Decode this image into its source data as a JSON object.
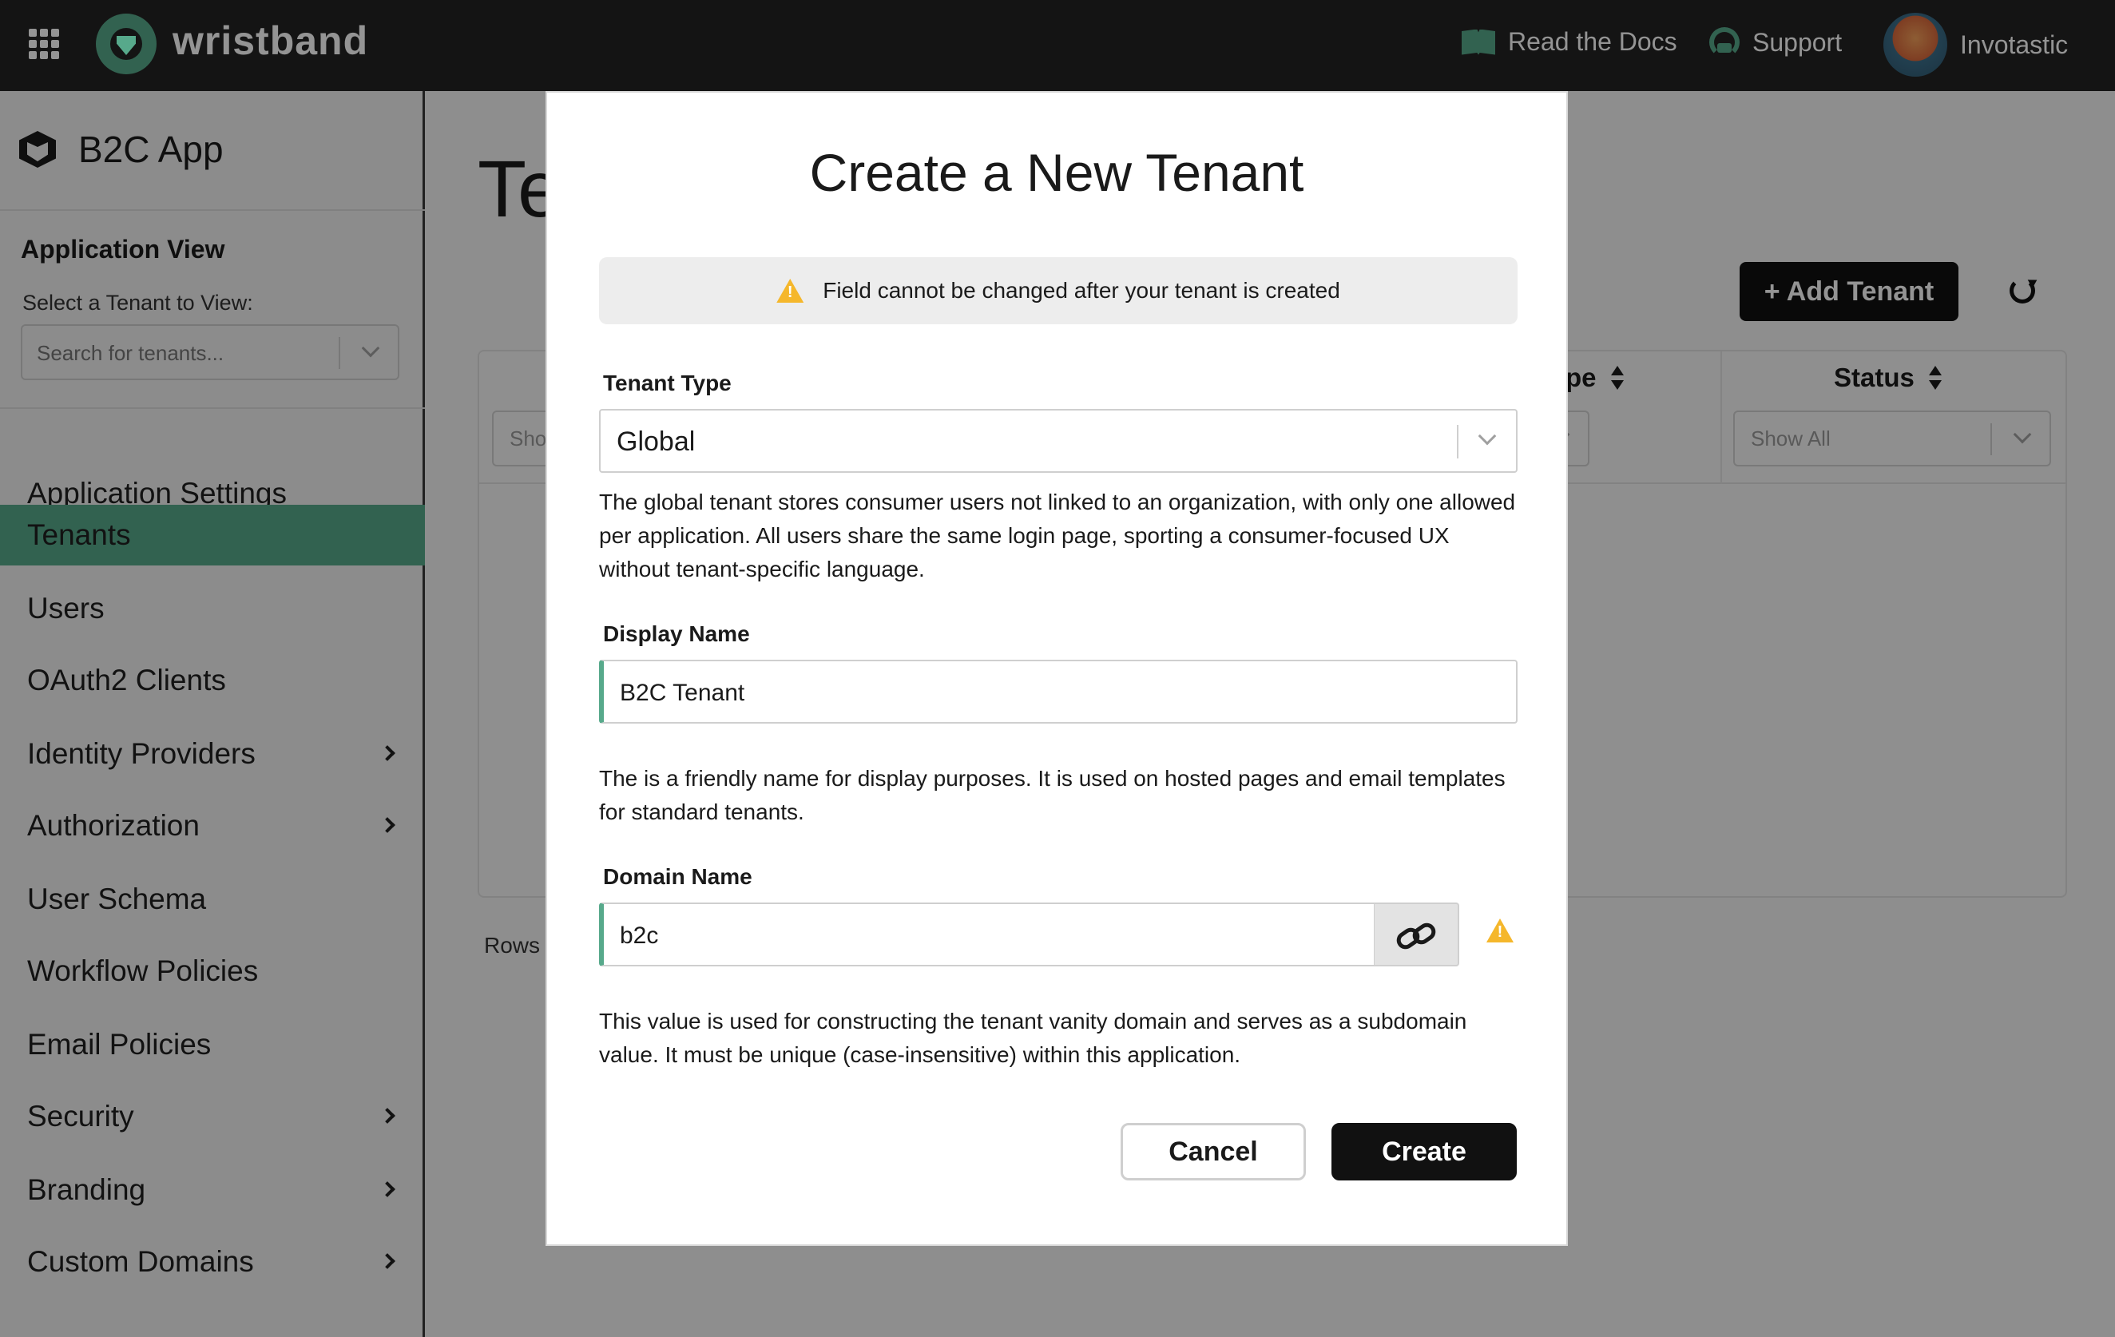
{
  "topbar": {
    "brand": "wristband",
    "links": [
      {
        "label": "Read the Docs",
        "icon": "book-icon"
      },
      {
        "label": "Support",
        "icon": "headset-icon"
      }
    ],
    "user": "Invotastic",
    "accent": "#57a98b"
  },
  "sidebar": {
    "app_name": "B2C App",
    "section_title": "Application View",
    "section_sub": "Select a Tenant to View:",
    "tenant_search_placeholder": "Search for tenants...",
    "items": [
      {
        "label": "Application Settings",
        "has_submenu": false,
        "active": false
      },
      {
        "label": "Tenants",
        "has_submenu": false,
        "active": true
      },
      {
        "label": "Users",
        "has_submenu": false,
        "active": false
      },
      {
        "label": "OAuth2 Clients",
        "has_submenu": false,
        "active": false
      },
      {
        "label": "Identity Providers",
        "has_submenu": true,
        "active": false
      },
      {
        "label": "Authorization",
        "has_submenu": true,
        "active": false
      },
      {
        "label": "User Schema",
        "has_submenu": false,
        "active": false
      },
      {
        "label": "Workflow Policies",
        "has_submenu": false,
        "active": false
      },
      {
        "label": "Email Policies",
        "has_submenu": false,
        "active": false
      },
      {
        "label": "Security",
        "has_submenu": true,
        "active": false
      },
      {
        "label": "Branding",
        "has_submenu": true,
        "active": false
      },
      {
        "label": "Custom Domains",
        "has_submenu": true,
        "active": false
      }
    ]
  },
  "main": {
    "title_visible": "Te",
    "add_button": "+ Add Tenant",
    "columns": [
      {
        "title": "pe",
        "filter": ""
      },
      {
        "title": "Status",
        "filter": "Show All"
      }
    ],
    "first_filter": "Sho",
    "rows_label": "Rows p"
  },
  "modal": {
    "title": "Create a New Tenant",
    "notice": "Field cannot be changed after your tenant is created",
    "tenant_type": {
      "label": "Tenant Type",
      "value": "Global",
      "help": "The global tenant stores consumer users not linked to an organization, with only one allowed per application. All users share the same login page, sporting a consumer-focused UX without tenant-specific language."
    },
    "display_name": {
      "label": "Display Name",
      "value": "B2C Tenant",
      "help": "The is a friendly name for display purposes. It is used on hosted pages and email templates for standard tenants."
    },
    "domain_name": {
      "label": "Domain Name",
      "value": "b2c",
      "help": "This value is used for constructing the tenant vanity domain and serves as a subdomain value. It must be unique (case-insensitive) within this application."
    },
    "cancel_label": "Cancel",
    "create_label": "Create"
  }
}
